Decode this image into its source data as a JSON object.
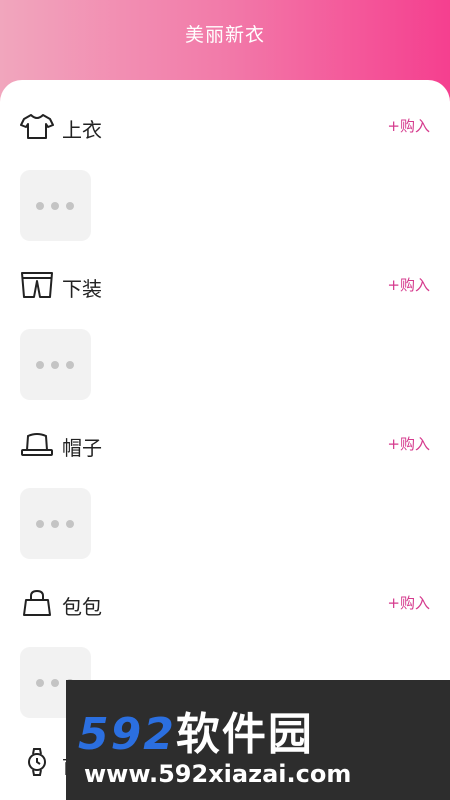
{
  "header": {
    "title": "美丽新衣"
  },
  "sections": [
    {
      "label": "上衣",
      "icon": "tshirt-icon",
      "action": "+购入"
    },
    {
      "label": "下装",
      "icon": "pants-icon",
      "action": "+购入"
    },
    {
      "label": "帽子",
      "icon": "hat-icon",
      "action": "+购入"
    },
    {
      "label": "包包",
      "icon": "bag-icon",
      "action": "+购入"
    },
    {
      "label": "首",
      "icon": "watch-icon",
      "action": ""
    }
  ],
  "watermark": {
    "brand_number": "592",
    "brand_text": "软件园",
    "url": "www.592xiazai.com"
  },
  "colors": {
    "accent": "#d53a8d",
    "header_start": "#f1a6bd",
    "header_end": "#f53f8f"
  }
}
